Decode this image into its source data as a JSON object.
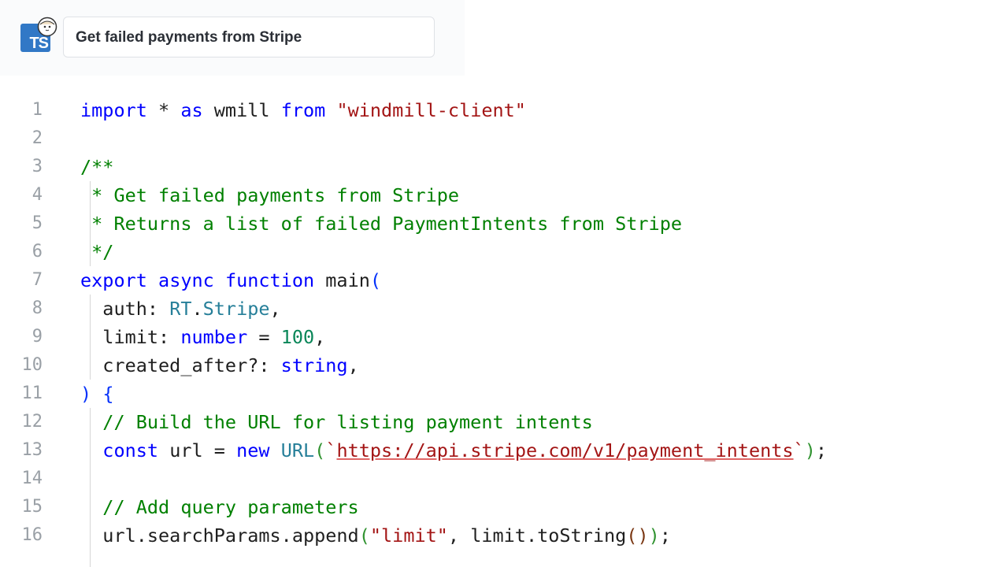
{
  "header": {
    "language_badge": "TS",
    "script_title": "Get failed payments from Stripe"
  },
  "editor": {
    "lines": [
      {
        "n": "1",
        "tokens": [
          [
            "kw",
            "import"
          ],
          [
            "p",
            " * "
          ],
          [
            "kw",
            "as"
          ],
          [
            "p",
            " wmill "
          ],
          [
            "kw",
            "from"
          ],
          [
            "p",
            " "
          ],
          [
            "str",
            "\"windmill-client\""
          ]
        ]
      },
      {
        "n": "2",
        "tokens": []
      },
      {
        "n": "3",
        "tokens": [
          [
            "cm",
            "/**"
          ]
        ]
      },
      {
        "n": "4",
        "tokens": [
          [
            "cm",
            " * Get failed payments from Stripe"
          ]
        ]
      },
      {
        "n": "5",
        "tokens": [
          [
            "cm",
            " * Returns a list of failed PaymentIntents from Stripe"
          ]
        ]
      },
      {
        "n": "6",
        "tokens": [
          [
            "cm",
            " */"
          ]
        ]
      },
      {
        "n": "7",
        "tokens": [
          [
            "kw",
            "export"
          ],
          [
            "p",
            " "
          ],
          [
            "kw",
            "async"
          ],
          [
            "p",
            " "
          ],
          [
            "kw",
            "function"
          ],
          [
            "p",
            " main"
          ],
          [
            "br1",
            "("
          ]
        ]
      },
      {
        "n": "8",
        "tokens": [
          [
            "p",
            "  auth: "
          ],
          [
            "ty",
            "RT"
          ],
          [
            "p",
            "."
          ],
          [
            "ty",
            "Stripe"
          ],
          [
            "p",
            ","
          ]
        ]
      },
      {
        "n": "9",
        "tokens": [
          [
            "p",
            "  limit: "
          ],
          [
            "kw",
            "number"
          ],
          [
            "p",
            " = "
          ],
          [
            "num",
            "100"
          ],
          [
            "p",
            ","
          ]
        ]
      },
      {
        "n": "10",
        "tokens": [
          [
            "p",
            "  created_after?: "
          ],
          [
            "kw",
            "string"
          ],
          [
            "p",
            ","
          ]
        ]
      },
      {
        "n": "11",
        "tokens": [
          [
            "br1",
            ")"
          ],
          [
            "p",
            " "
          ],
          [
            "br1",
            "{"
          ]
        ]
      },
      {
        "n": "12",
        "tokens": [
          [
            "cm",
            "  // Build the URL for listing payment intents"
          ]
        ]
      },
      {
        "n": "13",
        "tokens": [
          [
            "p",
            "  "
          ],
          [
            "kw",
            "const"
          ],
          [
            "p",
            " url = "
          ],
          [
            "kw",
            "new"
          ],
          [
            "p",
            " "
          ],
          [
            "ty",
            "URL"
          ],
          [
            "br2",
            "("
          ],
          [
            "str",
            "`"
          ],
          [
            "url",
            "https://api.stripe.com/v1/payment_intents"
          ],
          [
            "str",
            "`"
          ],
          [
            "br2",
            ")"
          ],
          [
            "p",
            ";"
          ]
        ]
      },
      {
        "n": "14",
        "tokens": []
      },
      {
        "n": "15",
        "tokens": [
          [
            "cm",
            "  // Add query parameters"
          ]
        ]
      },
      {
        "n": "16",
        "tokens": [
          [
            "p",
            "  url.searchParams.append"
          ],
          [
            "br2",
            "("
          ],
          [
            "str",
            "\"limit\""
          ],
          [
            "p",
            ", limit.toString"
          ],
          [
            "br3",
            "()"
          ],
          [
            "br2",
            ")"
          ],
          [
            "p",
            ";"
          ]
        ]
      }
    ]
  },
  "colors": {
    "keyword": "#0000ff",
    "string": "#a31515",
    "comment": "#008000",
    "type": "#267f99",
    "number": "#098658",
    "line_number": "#9aa0a6",
    "ts_badge": "#3178c6"
  }
}
